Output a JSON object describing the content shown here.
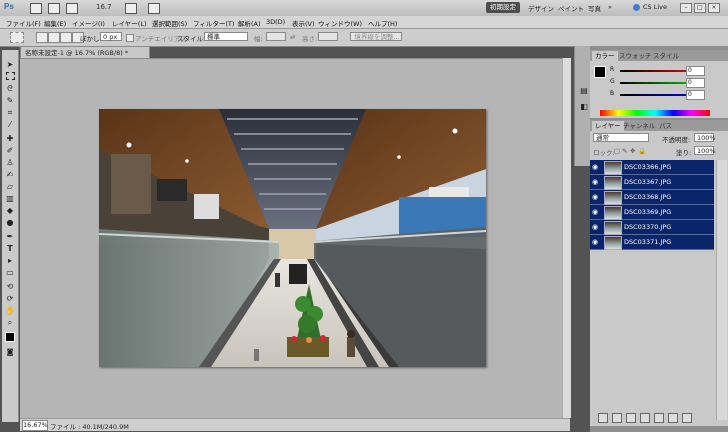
{
  "appbar": {
    "logo": "Ps",
    "zoom": "16.7",
    "workspace_current": "初期設定",
    "workspaces": [
      "デザイン",
      "ペイント",
      "写真"
    ],
    "cslive": "CS Live"
  },
  "menu": [
    "ファイル(F)",
    "編集(E)",
    "イメージ(I)",
    "レイヤー(L)",
    "選択範囲(S)",
    "フィルター(T)",
    "解析(A)",
    "3D(D)",
    "表示(V)",
    "ウィンドウ(W)",
    "ヘルプ(H)"
  ],
  "options": {
    "feather_label": "ぼかし:",
    "feather_value": "0 px",
    "antialias_label": "アンチエイリアス",
    "style_label": "スタイル:",
    "style_value": "標準",
    "width_label": "幅:",
    "height_label": "高さ:",
    "refine_button": "境界線を調整..."
  },
  "document": {
    "tab_title": "名称未設定-1 @ 16.7% (RGB/8) *",
    "zoom": "16.67%",
    "file_info": "ファイル : 40.1M/240.9M"
  },
  "color_panel": {
    "tabs": [
      "カラー",
      "スウォッチ",
      "スタイル"
    ],
    "channels": [
      {
        "label": "R",
        "value": "0",
        "color": "#d02020"
      },
      {
        "label": "G",
        "value": "0",
        "color": "#20a020"
      },
      {
        "label": "B",
        "value": "0",
        "color": "#2030c0"
      }
    ]
  },
  "layers_panel": {
    "tabs": [
      "レイヤー",
      "チャンネル",
      "パス"
    ],
    "blend_mode": "通常",
    "opacity_label": "不透明度:",
    "opacity_value": "100%",
    "lock_label": "ロック:",
    "fill_label": "塗り:",
    "fill_value": "100%",
    "layers": [
      "DSC03366.JPG",
      "DSC03367.JPG",
      "DSC03368.JPG",
      "DSC03369.JPG",
      "DSC03370.JPG",
      "DSC03371.JPG"
    ]
  },
  "colors": {
    "accent": "#0a246a",
    "workspace": "#b5b5b5"
  }
}
